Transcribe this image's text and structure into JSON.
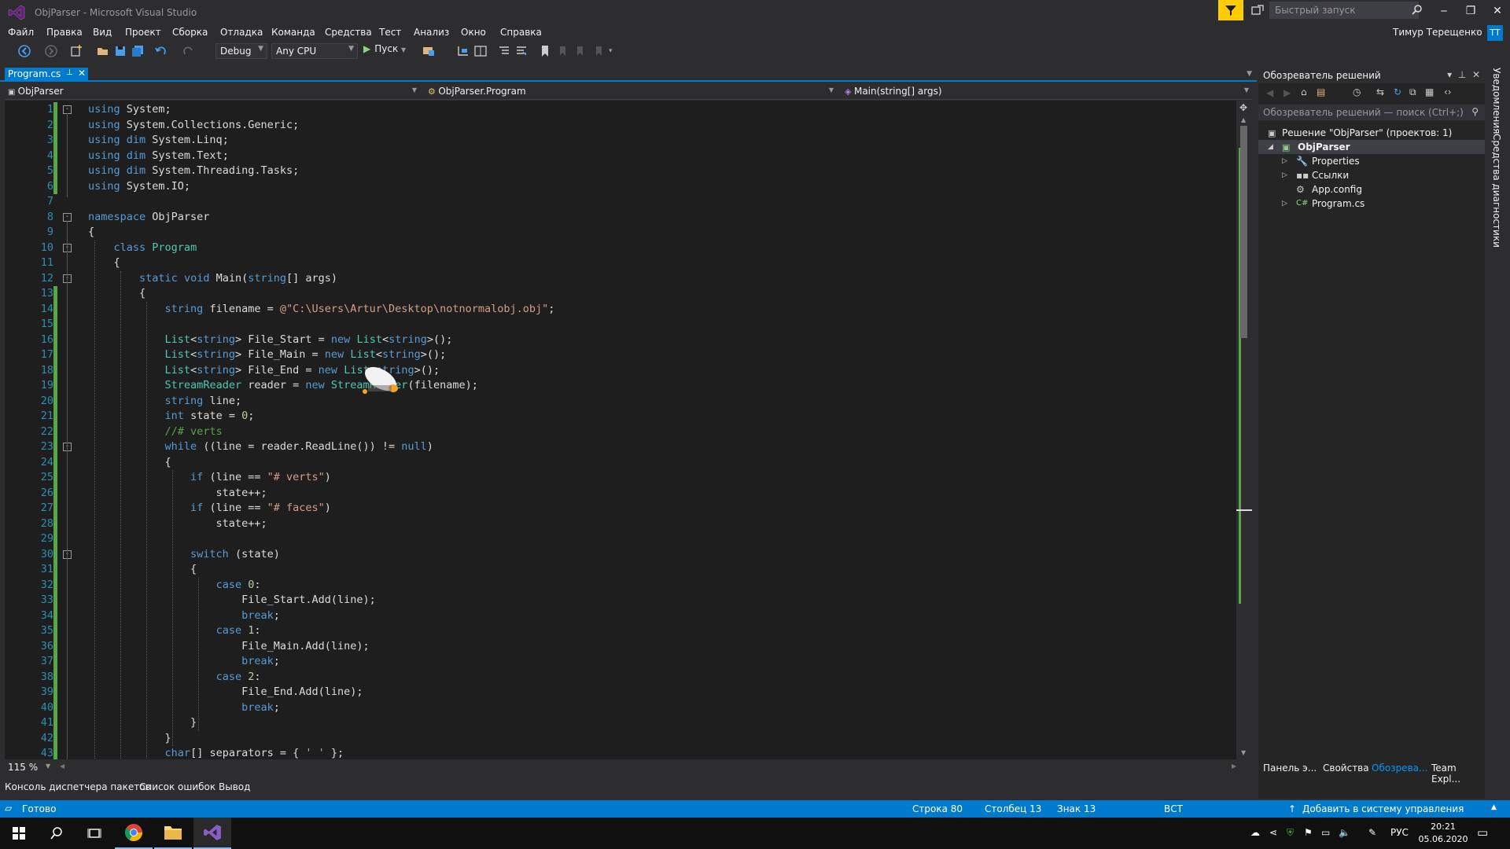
{
  "window": {
    "title": "ObjParser - Microsoft Visual Studio",
    "quick_launch_placeholder": "Быстрый запуск",
    "minimize": "‒",
    "restore": "❐",
    "close": "✕",
    "accent_color": "#007acc"
  },
  "menu": {
    "items": [
      "Файл",
      "Правка",
      "Вид",
      "Проект",
      "Сборка",
      "Отладка",
      "Команда",
      "Средства",
      "Тест",
      "Анализ",
      "Окно",
      "Справка"
    ],
    "user": "Тимур Терещенко",
    "user_initials": "ТТ"
  },
  "toolbar": {
    "configuration": "Debug",
    "platform": "Any CPU",
    "run_label": "Пуск"
  },
  "document_tab": {
    "name": "Program.cs",
    "pin": "⊥",
    "close": "✕"
  },
  "navbar": {
    "project": "ObjParser",
    "class": "ObjParser.Program",
    "member": "Main(string[] args)"
  },
  "editor": {
    "zoom": "115 %",
    "lines": [
      {
        "n": "1"
      },
      {
        "n": "2"
      },
      {
        "n": "3"
      },
      {
        "n": "4"
      },
      {
        "n": "5"
      },
      {
        "n": "6"
      },
      {
        "n": "7"
      },
      {
        "n": "8"
      },
      {
        "n": "9"
      },
      {
        "n": "10"
      },
      {
        "n": "11"
      },
      {
        "n": "12"
      },
      {
        "n": "13"
      },
      {
        "n": "14"
      },
      {
        "n": "15"
      },
      {
        "n": "16"
      },
      {
        "n": "17"
      },
      {
        "n": "18"
      },
      {
        "n": "19"
      },
      {
        "n": "20"
      },
      {
        "n": "21"
      },
      {
        "n": "22"
      },
      {
        "n": "23"
      },
      {
        "n": "24"
      },
      {
        "n": "25"
      },
      {
        "n": "26"
      },
      {
        "n": "27"
      },
      {
        "n": "28"
      },
      {
        "n": "29"
      },
      {
        "n": "30"
      },
      {
        "n": "31"
      },
      {
        "n": "32"
      },
      {
        "n": "33"
      },
      {
        "n": "34"
      },
      {
        "n": "35"
      },
      {
        "n": "36"
      },
      {
        "n": "37"
      },
      {
        "n": "38"
      },
      {
        "n": "39"
      },
      {
        "n": "40"
      },
      {
        "n": "41"
      },
      {
        "n": "42"
      },
      {
        "n": "43"
      }
    ]
  },
  "bottom_tabs": [
    "Консоль диспетчера пакетов",
    "Список ошибок",
    "Вывод"
  ],
  "status": {
    "ready": "Готово",
    "row": "Строка 80",
    "column": "Столбец 13",
    "char": "Знак 13",
    "mode": "ВСТ",
    "source_control": "Добавить в систему управления версиями"
  },
  "solution_explorer": {
    "title": "Обозреватель решений",
    "search_placeholder": "Обозреватель решений — поиск (Ctrl+;)",
    "solution": "Решение \"ObjParser\" (проектов: 1)",
    "project": "ObjParser",
    "items": [
      "Properties",
      "Ссылки",
      "App.config",
      "Program.cs"
    ],
    "bottom_tabs": [
      "Панель э...",
      "Свойства",
      "Обозрева...",
      "Team Expl..."
    ]
  },
  "side_tabs": [
    "Уведомления",
    "Средства диагностики"
  ],
  "taskbar": {
    "language": "РУС",
    "time": "20:21",
    "date": "05.06.2020"
  }
}
